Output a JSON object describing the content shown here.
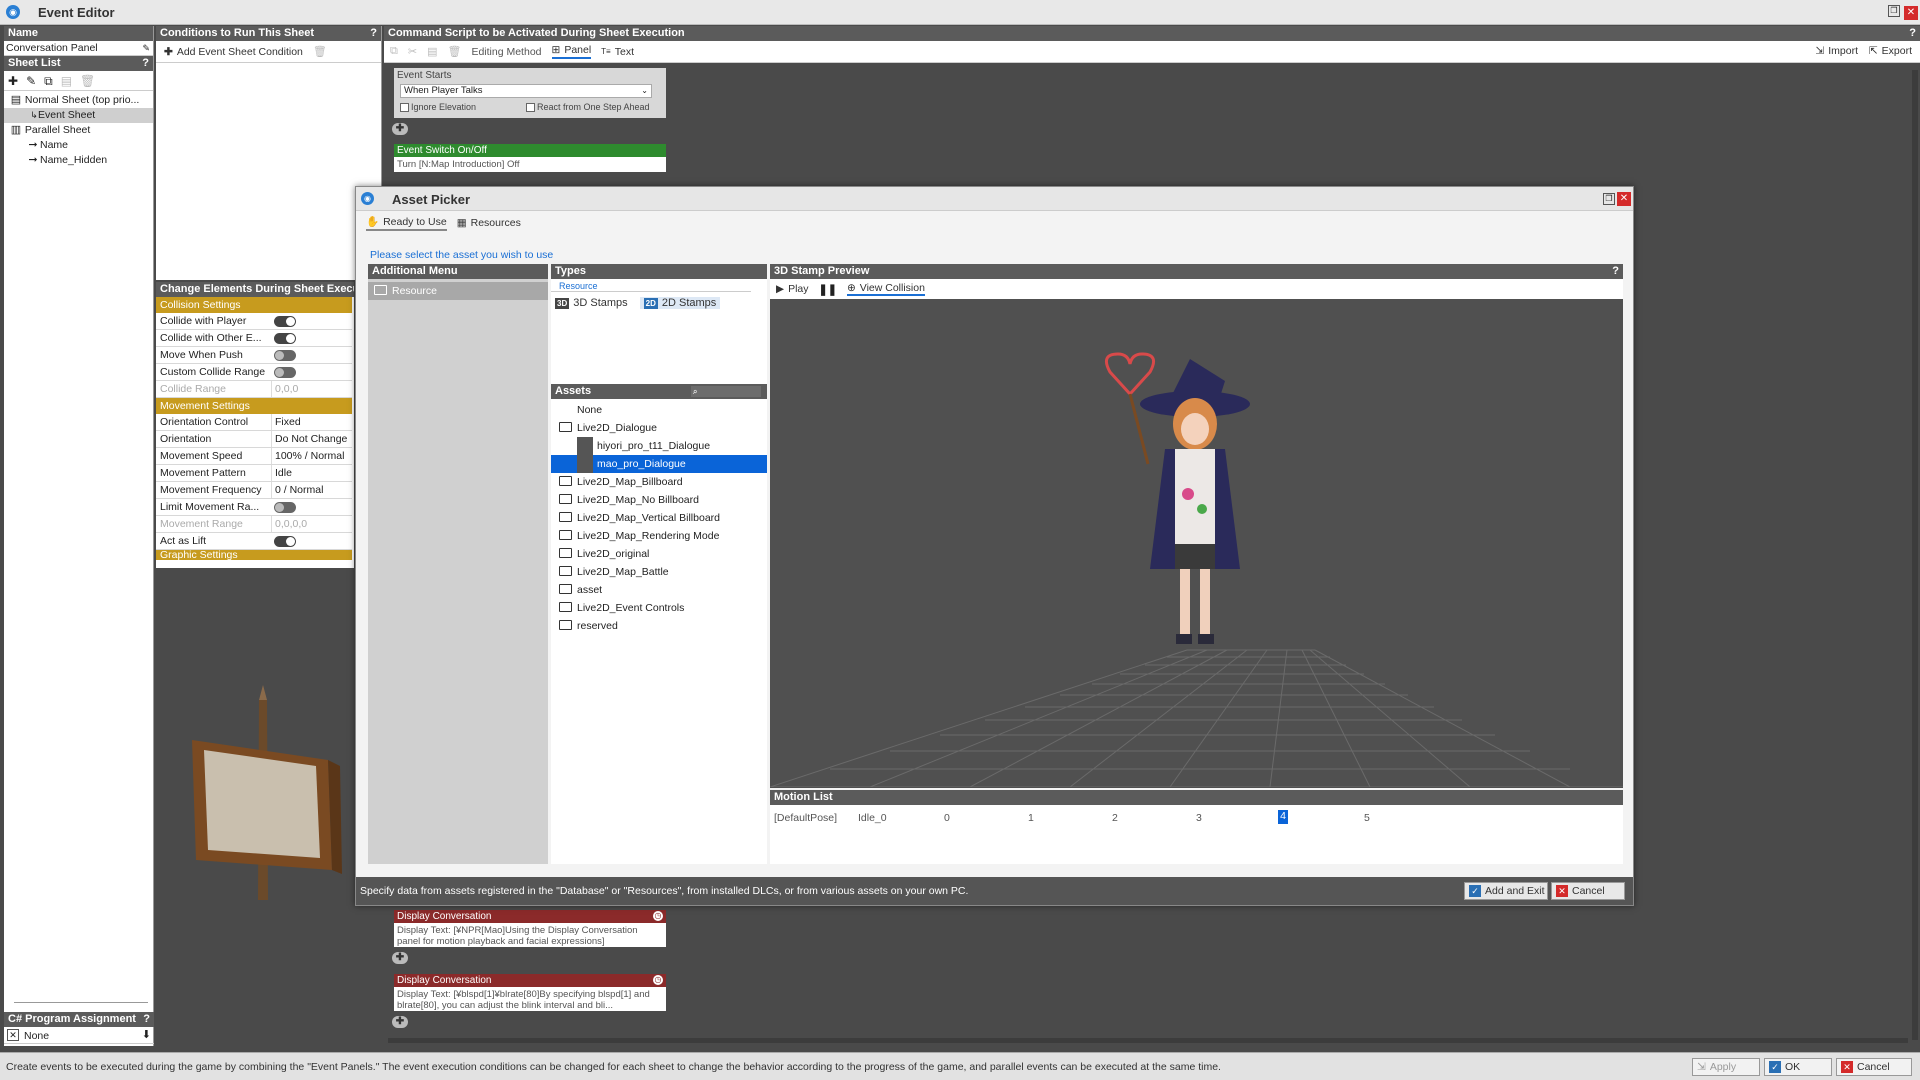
{
  "window": {
    "title": "Event Editor"
  },
  "name_panel": {
    "header": "Name",
    "value": "Conversation Panel"
  },
  "sheet_list": {
    "header": "Sheet List",
    "items": [
      {
        "label": "Normal Sheet (top prio..."
      },
      {
        "label": "Event Sheet"
      },
      {
        "label": "Parallel Sheet"
      },
      {
        "label": "Name"
      },
      {
        "label": "Name_Hidden"
      }
    ]
  },
  "csharp": {
    "header": "C# Program Assignment",
    "value": "None"
  },
  "conditions": {
    "header": "Conditions to Run This Sheet",
    "add_label": "Add Event Sheet Condition"
  },
  "change_elements": {
    "header": "Change Elements During Sheet Executio",
    "collision_header": "Collision Settings",
    "collide_player": "Collide with Player",
    "collide_other": "Collide with Other E...",
    "move_push": "Move When Push",
    "custom_range": "Custom Collide Range",
    "collide_range": "Collide Range",
    "collide_range_val": "0,0,0",
    "movement_header": "Movement Settings",
    "orient_ctrl": "Orientation Control",
    "orient_ctrl_val": "Fixed",
    "orientation": "Orientation",
    "orientation_val": "Do Not Change",
    "move_speed": "Movement Speed",
    "move_speed_val": "100% / Normal",
    "move_pattern": "Movement Pattern",
    "move_pattern_val": "Idle",
    "move_freq": "Movement Frequency",
    "move_freq_val": "0 / Normal",
    "limit_range": "Limit Movement Ra...",
    "move_range": "Movement Range",
    "move_range_val": "0,0,0,0",
    "act_lift": "Act as Lift",
    "graphic_header": "Graphic Settings"
  },
  "script": {
    "header": "Command Script to be Activated During Sheet Execution",
    "editing_method": "Editing Method",
    "panel": "Panel",
    "text": "Text",
    "import": "Import",
    "export": "Export",
    "event_starts": "Event Starts",
    "trigger": "When Player Talks",
    "ignore_elevation": "Ignore Elevation",
    "react_ahead": "React from One Step Ahead",
    "switch_title": "Event Switch On/Off",
    "switch_body": "Turn [N:Map Introduction] Off",
    "conv1_title": "Display Conversation",
    "conv1_body": "Display Text: [¥NPR[Mao]Using the Display Conversation panel for motion playback and facial expressions]",
    "conv2_title": "Display Conversation",
    "conv2_body": "Display Text: [¥blspd[1]¥blrate[80]By specifying blspd[1] and blrate[80], you can adjust the blink interval and bli..."
  },
  "asset_picker": {
    "title": "Asset Picker",
    "tab_ready": "Ready to Use",
    "tab_resources": "Resources",
    "instruction": "Please select the asset you wish to use",
    "additional_menu": "Additional Menu",
    "resource_item": "Resource",
    "types_header": "Types",
    "types_group": "Resource",
    "type_3d": "3D Stamps",
    "type_2d": "2D Stamps",
    "assets_header": "Assets",
    "assets": [
      {
        "label": "None"
      },
      {
        "label": "Live2D_Dialogue"
      },
      {
        "label": "hiyori_pro_t11_Dialogue"
      },
      {
        "label": "mao_pro_Dialogue"
      },
      {
        "label": "Live2D_Map_Billboard"
      },
      {
        "label": "Live2D_Map_No Billboard"
      },
      {
        "label": "Live2D_Map_Vertical Billboard"
      },
      {
        "label": "Live2D_Map_Rendering Mode"
      },
      {
        "label": "Live2D_original"
      },
      {
        "label": "Live2D_Map_Battle"
      },
      {
        "label": "asset"
      },
      {
        "label": "Live2D_Event Controls"
      },
      {
        "label": "reserved"
      }
    ],
    "preview_header": "3D Stamp Preview",
    "play": "Play",
    "view_collision": "View Collision",
    "motion_header": "Motion List",
    "motions": [
      "[DefaultPose]",
      "Idle_0",
      "0",
      "1",
      "2",
      "3",
      "4",
      "5"
    ],
    "footer_text": "Specify data from assets registered in the \"Database\" or \"Resources\", from installed DLCs, or from various assets on your own PC.",
    "add_exit": "Add and Exit",
    "cancel": "Cancel"
  },
  "status": {
    "text": "Create events to be executed during the game by combining the \"Event Panels.\"  The event execution conditions can be changed for each sheet to change the behavior according to the progress of the game, and parallel events can be executed at the same time.",
    "apply": "Apply",
    "ok": "OK",
    "cancel": "Cancel"
  },
  "colors": {
    "accent": "#c79b1e",
    "selection": "#0a64d8",
    "green_panel": "#2e8b2e",
    "red_panel": "#8b2a2a"
  }
}
